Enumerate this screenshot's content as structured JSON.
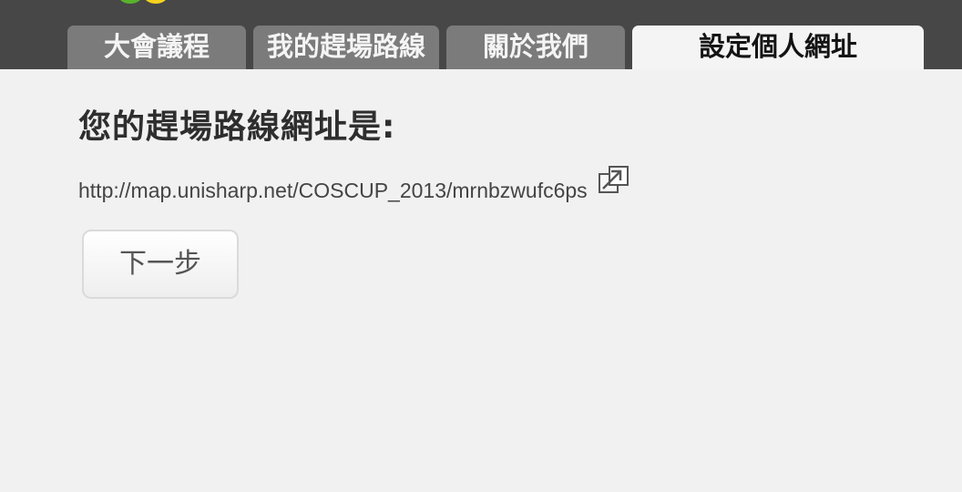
{
  "nav": {
    "tabs": [
      {
        "label": "大會議程",
        "active": false
      },
      {
        "label": "我的趕場路線",
        "active": false
      },
      {
        "label": "關於我們",
        "active": false
      },
      {
        "label": "設定個人網址",
        "active": true
      }
    ]
  },
  "main": {
    "heading": "您的趕場路線網址是:",
    "url": "http://map.unisharp.net/COSCUP_2013/mrnbzwufc6ps",
    "open_link_icon": "external-link-icon",
    "next_button_label": "下一步"
  },
  "colors": {
    "topbar": "#474747",
    "tab_inactive": "#7b7b7b",
    "tab_active": "#f4f4f4",
    "page_background": "#f1f1f1"
  }
}
